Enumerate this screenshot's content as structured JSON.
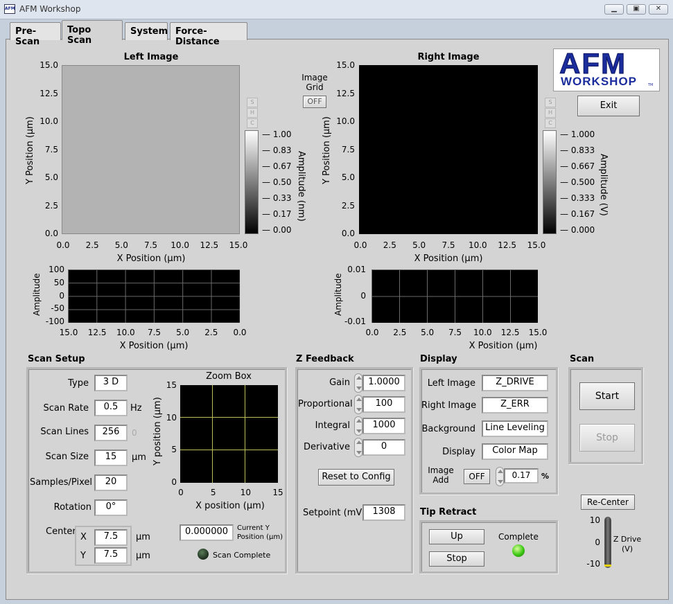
{
  "window": {
    "title": "AFM Workshop",
    "app_icon": "AFM",
    "min_glyph": "▁",
    "max_glyph": "▣",
    "close_glyph": "✕"
  },
  "tabs": [
    "Pre-Scan",
    "Topo Scan",
    "System",
    "Force-Distance"
  ],
  "active_tab": "Topo Scan",
  "logo": {
    "line1": "AFM",
    "line2": "WORKSHOP",
    "tm": "TM"
  },
  "exit_label": "Exit",
  "left_image": {
    "title": "Left Image",
    "y_label": "Y Position (µm)",
    "x_label": "X Position (µm)",
    "y_ticks": [
      "15.0",
      "12.5",
      "10.0",
      "7.5",
      "5.0",
      "2.5",
      "0.0"
    ],
    "x_ticks": [
      "0.0",
      "2.5",
      "5.0",
      "7.5",
      "10.0",
      "12.5",
      "15.0"
    ],
    "colorbar_label": "Amplitude (nm)",
    "colorbar_ticks": [
      "1.00",
      "0.83",
      "0.67",
      "0.50",
      "0.33",
      "0.17",
      "0.00"
    ],
    "shc": [
      "S",
      "H",
      "C"
    ],
    "fill": "#b3b3b3"
  },
  "right_image": {
    "title": "Right Image",
    "y_label": "Y Position (µm)",
    "x_label": "X Position (µm)",
    "y_ticks": [
      "15.0",
      "12.5",
      "10.0",
      "7.5",
      "5.0",
      "2.5",
      "0.0"
    ],
    "x_ticks": [
      "0.0",
      "2.5",
      "5.0",
      "7.5",
      "10.0",
      "12.5",
      "15.0"
    ],
    "colorbar_label": "Amplitude (V)",
    "colorbar_ticks": [
      "1.000",
      "0.833",
      "0.667",
      "0.500",
      "0.333",
      "0.167",
      "0.000"
    ],
    "shc": [
      "S",
      "H",
      "C"
    ],
    "fill": "#000000"
  },
  "image_grid": {
    "label_line1": "Image",
    "label_line2": "Grid",
    "value": "OFF"
  },
  "left_profile": {
    "y_label": "Amplitude",
    "y_ticks": [
      "100",
      "50",
      "0",
      "-50",
      "-100"
    ],
    "x_ticks": [
      "15.0",
      "12.5",
      "10.0",
      "7.5",
      "5.0",
      "2.5",
      "0.0"
    ],
    "x_label": "X Position (µm)"
  },
  "right_profile": {
    "y_label": "Amplitude",
    "y_ticks": [
      "0.01",
      "0",
      "-0.01"
    ],
    "x_ticks": [
      "0.0",
      "2.5",
      "5.0",
      "7.5",
      "10.0",
      "12.5",
      "15.0"
    ],
    "x_label": "X Position (µm)"
  },
  "scan_setup": {
    "title": "Scan Setup",
    "type_label": "Type",
    "type_value": "3 D",
    "rate_label": "Scan Rate",
    "rate_value": "0.5",
    "rate_unit": "Hz",
    "lines_label": "Scan Lines",
    "lines_value": "256",
    "lines_extra": "0",
    "size_label": "Scan Size",
    "size_value": "15",
    "size_unit": "µm",
    "spp_label": "Samples/Pixel",
    "spp_value": "20",
    "rotation_label": "Rotation",
    "rotation_value": "0°",
    "center_label": "Center",
    "x_label": "X",
    "x_value": "7.5",
    "x_unit": "µm",
    "y_label": "Y",
    "y_value": "7.5",
    "y_unit": "µm"
  },
  "zoom_box": {
    "title": "Zoom Box",
    "y_label": "Y position (µm)",
    "x_label": "X position (µm)",
    "y_ticks": [
      "15",
      "10",
      "5",
      "0"
    ],
    "x_ticks": [
      "0",
      "5",
      "10",
      "15"
    ],
    "current_y_value": "0.000000",
    "current_y_label1": "Current Y",
    "current_y_label2": "Position (µm)",
    "scan_complete_label": "Scan Complete"
  },
  "z_feedback": {
    "title": "Z Feedback",
    "gain_label": "Gain",
    "gain_value": "1.0000",
    "prop_label": "Proportional",
    "prop_value": "100",
    "int_label": "Integral",
    "int_value": "1000",
    "deriv_label": "Derivative",
    "deriv_value": "0",
    "reset_label": "Reset to Config",
    "setpoint_label": "Setpoint (mV)",
    "setpoint_value": "1308"
  },
  "display": {
    "title": "Display",
    "left_label": "Left Image",
    "left_value": "Z_DRIVE",
    "right_label": "Right Image",
    "right_value": "Z_ERR",
    "bg_label": "Background",
    "bg_value": "Line Leveling",
    "display_label": "Display",
    "display_value": "Color Map",
    "add_label1": "Image",
    "add_label2": "Add",
    "add_toggle": "OFF",
    "add_value": "0.17",
    "add_unit": "%"
  },
  "tip_retract": {
    "title": "Tip Retract",
    "up_label": "Up",
    "stop_label": "Stop",
    "complete_label": "Complete"
  },
  "scan": {
    "title": "Scan",
    "start_label": "Start",
    "stop_label": "Stop",
    "recenter_label": "Re-Center"
  },
  "z_drive": {
    "label1": "Z Drive",
    "label2": "(V)",
    "ticks": [
      "10",
      "0",
      "-10"
    ],
    "level_fraction": 0.0
  }
}
